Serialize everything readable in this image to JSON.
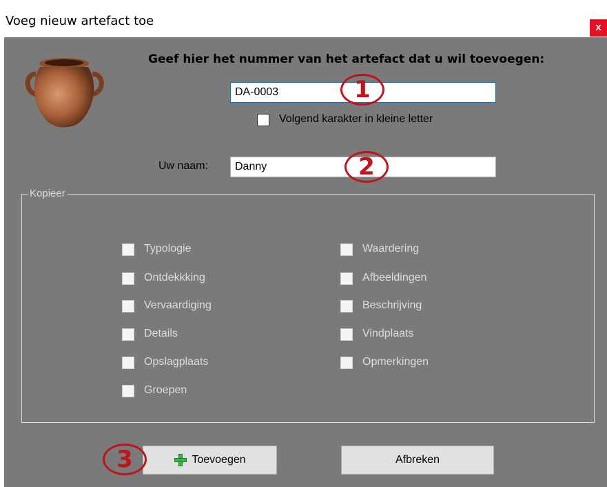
{
  "window": {
    "title": "Voeg nieuw artefact toe",
    "close_glyph": "x"
  },
  "artifact_icon": "clay-pot-icon",
  "number_section": {
    "prompt": "Geef hier het nummer van het artefact dat u wil toevoegen:",
    "value": "DA-0003",
    "lowercase_checkbox": {
      "label": "Volgend karakter in kleine letter",
      "checked": false
    }
  },
  "name_section": {
    "label": "Uw naam:",
    "value": "Danny"
  },
  "copy_group": {
    "legend": "Kopieer",
    "left_options": [
      {
        "label": "Typologie",
        "checked": false
      },
      {
        "label": "Ontdekkking",
        "checked": false
      },
      {
        "label": "Vervaardiging",
        "checked": false
      },
      {
        "label": "Details",
        "checked": false
      },
      {
        "label": "Opslagplaats",
        "checked": false
      },
      {
        "label": "Groepen",
        "checked": false
      }
    ],
    "right_options": [
      {
        "label": "Waardering",
        "checked": false
      },
      {
        "label": "Afbeeldingen",
        "checked": false
      },
      {
        "label": "Beschrijving",
        "checked": false
      },
      {
        "label": "Vindplaats",
        "checked": false
      },
      {
        "label": "Opmerkingen",
        "checked": false
      }
    ]
  },
  "buttons": {
    "add_label": "Toevoegen",
    "add_icon": "green-plus-icon",
    "cancel_label": "Afbreken"
  },
  "annotations": {
    "marker_1": "1",
    "marker_2": "2",
    "marker_3": "3"
  },
  "colors": {
    "window_bg": "#7a7a7a",
    "close_button": "#e81123",
    "annotation_red": "#c0141c",
    "disabled_text": "#dcdcdc"
  }
}
